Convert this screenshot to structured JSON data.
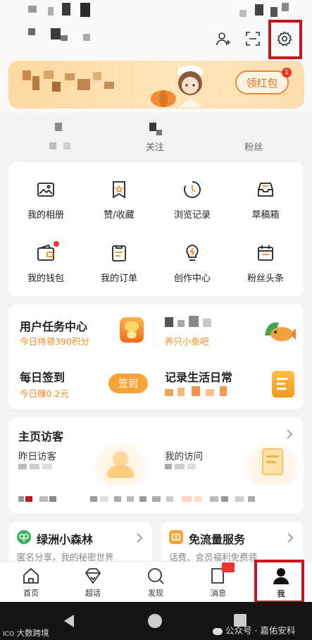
{
  "banner": {
    "button_label": "领红包",
    "badge_count": "1"
  },
  "stats": {
    "following_label": "关注",
    "fans_label": "粉丝"
  },
  "shortcuts": [
    {
      "label": "我的相册",
      "icon": "photo-album-icon"
    },
    {
      "label": "赞/收藏",
      "icon": "like-collect-icon"
    },
    {
      "label": "浏览记录",
      "icon": "history-icon"
    },
    {
      "label": "草稿箱",
      "icon": "drafts-icon"
    },
    {
      "label": "我的钱包",
      "icon": "wallet-icon"
    },
    {
      "label": "我的订单",
      "icon": "order-icon"
    },
    {
      "label": "创作中心",
      "icon": "creator-icon"
    },
    {
      "label": "粉丝头条",
      "icon": "calendar-icon"
    }
  ],
  "tasks": {
    "task_center_title": "用户任务中心",
    "task_center_sub": "今日待领390积分",
    "fish_sub": "养只小鱼吧",
    "signin_title": "每日签到",
    "signin_sub": "今日赚0.2元",
    "signin_button": "签到",
    "life_title": "记录生活日常"
  },
  "visitors": {
    "title": "主页访客",
    "left_label": "昨日访客",
    "right_label": "我的访问"
  },
  "promo": {
    "forest_title": "绿洲小森林",
    "forest_sub": "匿名分享，我的秘密世界",
    "traffic_title": "免流量服务",
    "traffic_sub": "话费、会员福利免费领"
  },
  "nav": [
    {
      "label": "首页",
      "icon": "home-icon"
    },
    {
      "label": "超话",
      "icon": "diamond-icon"
    },
    {
      "label": "发现",
      "icon": "search-icon"
    },
    {
      "label": "消息",
      "icon": "message-icon"
    },
    {
      "label": "我",
      "icon": "profile-icon"
    }
  ],
  "watermarks": {
    "left": "大数跨境",
    "right": "公众号 · 嘉佑安科"
  },
  "colors": {
    "accent_orange": "#f28a1f",
    "highlight_red": "#c4171a",
    "button_orange": "#f9a436"
  }
}
